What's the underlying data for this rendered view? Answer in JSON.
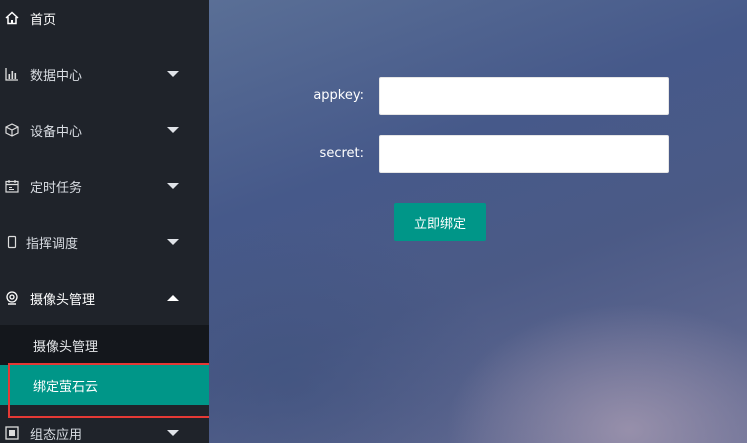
{
  "sidebar": {
    "items": [
      {
        "label": "首页",
        "icon": "home-icon"
      },
      {
        "label": "数据中心",
        "icon": "chart-icon"
      },
      {
        "label": "设备中心",
        "icon": "cube-icon"
      },
      {
        "label": "定时任务",
        "icon": "calendar-icon"
      },
      {
        "label": "指挥调度",
        "icon": "phone-icon"
      },
      {
        "label": "摄像头管理",
        "icon": "camera-icon"
      },
      {
        "label": "组态应用",
        "icon": "app-icon"
      }
    ],
    "submenu": [
      {
        "label": "摄像头管理"
      },
      {
        "label": "绑定萤石云"
      }
    ],
    "active_color": "#009688"
  },
  "form": {
    "appkey_label": "appkey:",
    "appkey_value": "",
    "secret_label": "secret:",
    "secret_value": "",
    "bind_button": "立即绑定"
  },
  "colors": {
    "sidebar_bg": "#1f232a",
    "accent": "#009688",
    "highlight_border": "#e53935"
  }
}
